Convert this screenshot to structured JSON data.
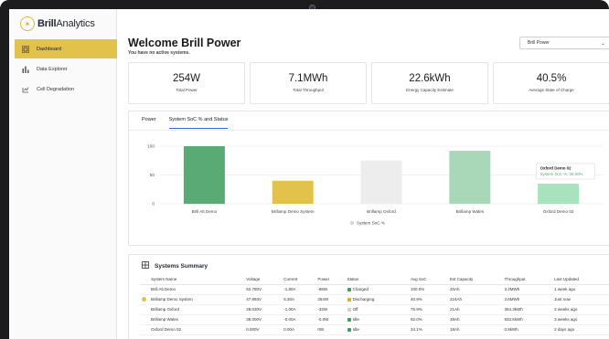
{
  "app": {
    "brand_bold": "Brill",
    "brand_rest": "Analytics"
  },
  "sidebar": {
    "items": [
      {
        "label": "Dashboard",
        "icon": "grid-icon",
        "active": true
      },
      {
        "label": "Data Explorer",
        "icon": "bar-chart-icon",
        "active": false
      },
      {
        "label": "Cell Degradation",
        "icon": "battery-icon",
        "active": false
      }
    ]
  },
  "header": {
    "title": "Welcome Brill Power",
    "subtitle": "You have no active systems.",
    "select_value": "Brill Power"
  },
  "stats": [
    {
      "value": "254W",
      "label": "Total Power"
    },
    {
      "value": "7.1MWh",
      "label": "Total Throughput"
    },
    {
      "value": "22.6kWh",
      "label": "Energy Capacity Estimate"
    },
    {
      "value": "40.5%",
      "label": "Average State of Charge"
    }
  ],
  "chart_tabs": [
    {
      "label": "Power",
      "active": false
    },
    {
      "label": "System SoC % and Status",
      "active": true
    }
  ],
  "chart_data": {
    "type": "bar",
    "categories": [
      "Brill Alt Demo",
      "Brillamp Demo System",
      "Brillamp Oxford",
      "Brillamp Wales",
      "Oxford Demo 02"
    ],
    "values": [
      100,
      40,
      75,
      92,
      35
    ],
    "colors": [
      "#5aab73",
      "#e2c24a",
      "#ededed",
      "#a8d8b7",
      "#a8e3bd"
    ],
    "ylim": [
      0,
      100
    ],
    "yticks": [
      0,
      50,
      100
    ],
    "legend": "System SoC %",
    "legend_position": "bottom",
    "grid": true,
    "tooltip": {
      "title": "Oxford Demo 02",
      "text": "System SoC %: 35.00%"
    }
  },
  "table": {
    "title": "Systems Summary",
    "columns": [
      "System Name",
      "Voltage",
      "Current",
      "Power",
      "Status",
      "Avg SoC",
      "Est Capacity",
      "Throughput",
      "Last Updated"
    ],
    "rows": [
      {
        "marker": false,
        "cells": [
          "Brill Alt Demo",
          "52.780V",
          "-1.80A",
          "-95W",
          "Charged",
          "100.0%",
          "20Ah",
          "3.2MWh",
          "1 week ago"
        ],
        "status_color": "#3e9c5c"
      },
      {
        "marker": true,
        "cells": [
          "Brillamp Demo System",
          "47.893V",
          "5.30A",
          "254W",
          "Discharging",
          "40.9%",
          "224Ah",
          "3.6MWh",
          "Just now"
        ],
        "status_color": "#e2a72e"
      },
      {
        "marker": false,
        "cells": [
          "Brillamp Oxford",
          "28.030V",
          "-1.00A",
          "-32W",
          "Off",
          "75.9%",
          "21Ah",
          "354.3kWh",
          "2 weeks ago"
        ],
        "status_color": "#cfcfcf"
      },
      {
        "marker": false,
        "cells": [
          "Brillamp Wales",
          "38.000V",
          "-0.00A",
          "-0.0W",
          "Idle",
          "92.0%",
          "38Ah",
          "933.6kWh",
          "3 weeks ago"
        ],
        "status_color": "#3e9c5c"
      },
      {
        "marker": false,
        "cells": [
          "Oxford Demo 02",
          "0.000V",
          "0.00A",
          "0W",
          "Idle",
          "34.1%",
          "18Ah",
          "0.8kWh",
          "2 days ago"
        ],
        "status_color": "#3e9c5c"
      }
    ]
  }
}
